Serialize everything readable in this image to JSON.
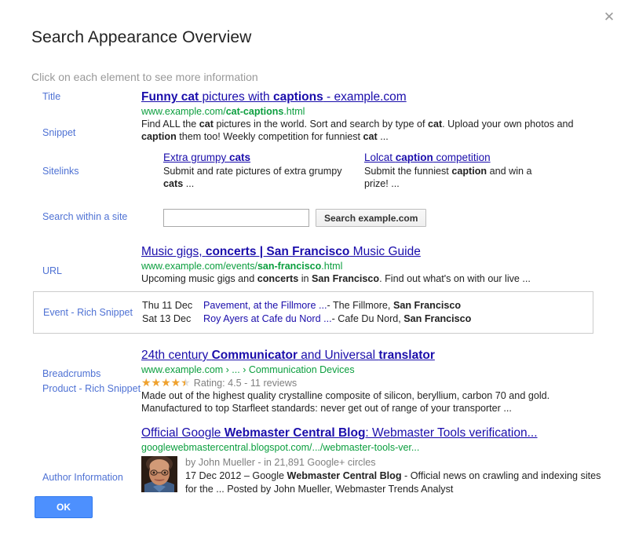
{
  "dialog": {
    "title": "Search Appearance Overview",
    "subtitle": "Click on each element to see more information",
    "close_icon": "close-icon",
    "ok_label": "OK",
    "accent_color": "#4d90fe",
    "label_color": "#4f72d4",
    "link_color": "#1a0dab",
    "url_color": "#0b9e3e",
    "star_color": "#f0a22e"
  },
  "labels": {
    "title": "Title",
    "snippet": "Snippet",
    "sitelinks": "Sitelinks",
    "search_within_a_site": "Search within a site",
    "url": "URL",
    "event_rich_snippet": "Event - Rich Snippet",
    "breadcrumbs": "Breadcrumbs",
    "product_rich_snippet": "Product - Rich Snippet",
    "author_information": "Author Information"
  },
  "results": {
    "cats": {
      "title_parts": [
        {
          "text": "Funny cat",
          "bold": true
        },
        {
          "text": " pictures with ",
          "bold": false
        },
        {
          "text": "captions",
          "bold": true
        },
        {
          "text": " - example.com",
          "bold": false
        }
      ],
      "url_parts": [
        {
          "text": "www.example.com/",
          "bold": false
        },
        {
          "text": "cat-captions",
          "bold": true
        },
        {
          "text": ".html",
          "bold": false
        }
      ],
      "snippet_parts": [
        {
          "text": "Find ALL the ",
          "bold": false
        },
        {
          "text": "cat",
          "bold": true
        },
        {
          "text": " pictures in the world. Sort and search by type of ",
          "bold": false
        },
        {
          "text": "cat",
          "bold": true
        },
        {
          "text": ". Upload your own photos and ",
          "bold": false
        },
        {
          "text": "caption",
          "bold": true
        },
        {
          "text": " them too! Weekly competition for funniest ",
          "bold": false
        },
        {
          "text": "cat",
          "bold": true
        },
        {
          "text": " ...",
          "bold": false
        }
      ]
    },
    "sitelinks": [
      {
        "title_parts": [
          {
            "text": "Extra grumpy ",
            "bold": false
          },
          {
            "text": "cats",
            "bold": true
          }
        ],
        "desc_parts": [
          {
            "text": "Submit and rate pictures of extra grumpy ",
            "bold": false
          },
          {
            "text": "cats",
            "bold": true
          },
          {
            "text": " ...",
            "bold": false
          }
        ]
      },
      {
        "title_parts": [
          {
            "text": "Lolcat ",
            "bold": false
          },
          {
            "text": "caption",
            "bold": true
          },
          {
            "text": " competition",
            "bold": false
          }
        ],
        "desc_parts": [
          {
            "text": "Submit the funniest ",
            "bold": false
          },
          {
            "text": "caption",
            "bold": true
          },
          {
            "text": " and win a prize! ...",
            "bold": false
          }
        ]
      }
    ],
    "site_search": {
      "input_value": "",
      "input_placeholder": "",
      "button_label": "Search example.com"
    },
    "music": {
      "title_parts": [
        {
          "text": "Music gigs, ",
          "bold": false
        },
        {
          "text": "concerts | San Francisco",
          "bold": true
        },
        {
          "text": " Music Guide",
          "bold": false
        }
      ],
      "url_parts": [
        {
          "text": "www.example.com/events/",
          "bold": false
        },
        {
          "text": "san-francisco",
          "bold": true
        },
        {
          "text": ".html",
          "bold": false
        }
      ],
      "snippet_parts": [
        {
          "text": "Upcoming music gigs and ",
          "bold": false
        },
        {
          "text": "concerts",
          "bold": true
        },
        {
          "text": " in ",
          "bold": false
        },
        {
          "text": "San Francisco",
          "bold": true
        },
        {
          "text": ". Find out what's on with our live ...",
          "bold": false
        }
      ]
    },
    "events": [
      {
        "date": "Thu 11 Dec",
        "link": "Pavement, at the Fillmore ...",
        "venue_parts": [
          {
            "text": " - The Fillmore, ",
            "bold": false
          },
          {
            "text": "San Francisco",
            "bold": true
          }
        ]
      },
      {
        "date": "Sat 13 Dec",
        "link": "Roy Ayers at Cafe du Nord ...",
        "venue_parts": [
          {
            "text": " - Cafe Du Nord, ",
            "bold": false
          },
          {
            "text": "San Francisco",
            "bold": true
          }
        ]
      }
    ],
    "product": {
      "title_parts": [
        {
          "text": "24th century ",
          "bold": false
        },
        {
          "text": "Communicator",
          "bold": true
        },
        {
          "text": " and Universal ",
          "bold": false
        },
        {
          "text": "translator",
          "bold": true
        }
      ],
      "breadcrumb_parts": [
        {
          "text": "www.example.com › ... › Communication Devices",
          "bold": false
        }
      ],
      "rating_value": 4.5,
      "rating_max": 5,
      "rating_text": "Rating: 4.5 - 11 reviews",
      "snippet_parts": [
        {
          "text": "Made out of the highest quality crystalline composite of silicon, beryllium, carbon 70 and gold. Manufactured to top Starfleet standards: never get out of range of your transporter ...",
          "bold": false
        }
      ]
    },
    "author": {
      "title_parts": [
        {
          "text": "Official Google ",
          "bold": false
        },
        {
          "text": "Webmaster Central Blog",
          "bold": true
        },
        {
          "text": ": Webmaster Tools verification...",
          "bold": false
        }
      ],
      "url_parts": [
        {
          "text": "googlewebmastercentral.blogspot.com/.../webmaster-tools-ver...",
          "bold": false
        }
      ],
      "photo_alt": "author-photo",
      "byline": "by John Mueller - in 21,891 Google+ circles",
      "snippet_parts": [
        {
          "text": "17 Dec 2012 – Google ",
          "bold": false
        },
        {
          "text": "Webmaster Central Blog",
          "bold": true
        },
        {
          "text": " - Official news on crawling and indexing  sites for the ... Posted by John Mueller, Webmaster Trends Analyst",
          "bold": false
        }
      ]
    }
  }
}
